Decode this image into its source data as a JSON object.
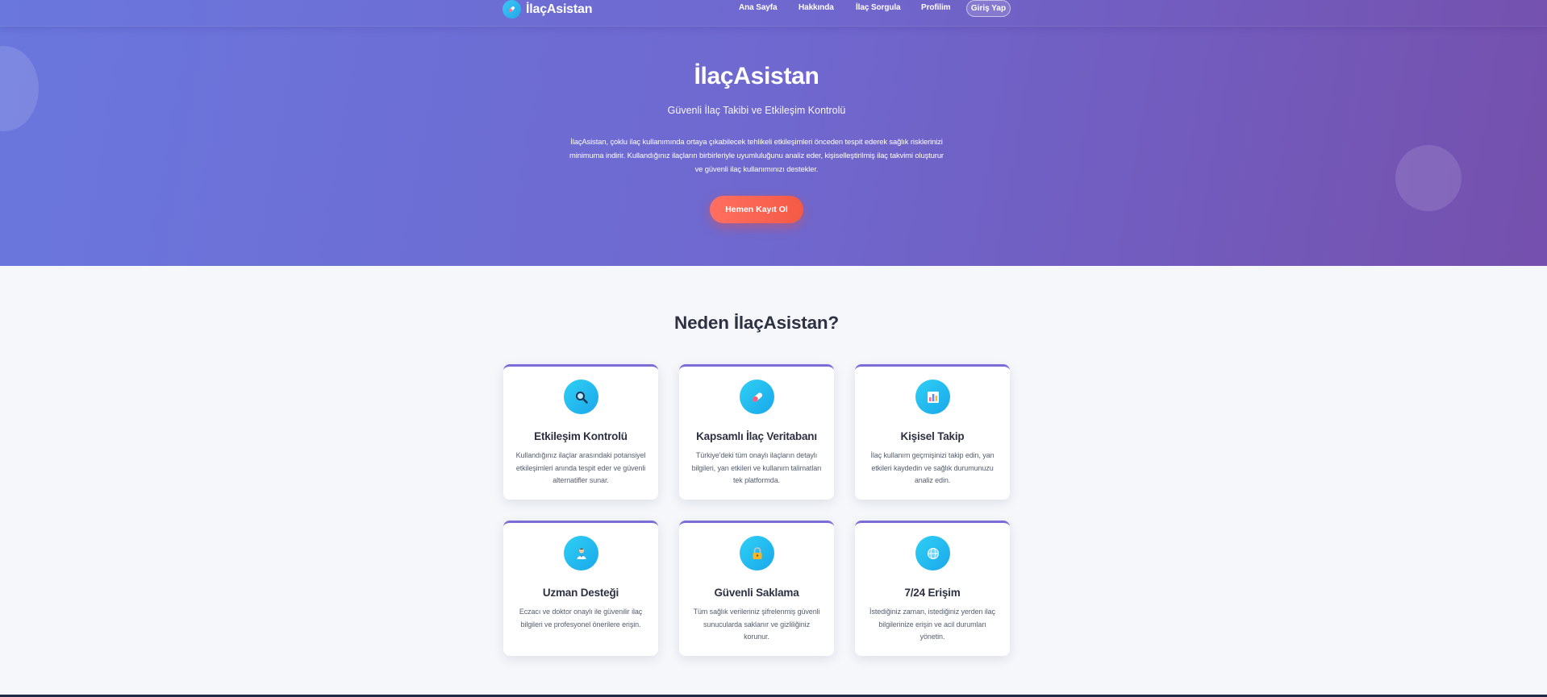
{
  "brand": {
    "name": "İlaçAsistan"
  },
  "nav": {
    "items": [
      "Ana Sayfa",
      "Hakkında",
      "İlaç Sorgula",
      "Profilim"
    ],
    "login_label": "Giriş Yap"
  },
  "hero": {
    "title": "İlaçAsistan",
    "subtitle": "Güvenli İlaç Takibi ve Etkileşim Kontrolü",
    "description": "İlaçAsistan, çoklu ilaç kullanımında ortaya çıkabilecek tehlikeli etkileşimleri önceden tespit ederek sağlık risklerinizi minimuma indirir. Kullandığınız ilaçların birbirleriyle uyumluluğunu analiz eder, kişiselleştirilmiş ilaç takvimi oluşturur ve güvenli ilaç kullanımınızı destekler.",
    "cta_label": "Hemen Kayıt Ol"
  },
  "features": {
    "title": "Neden İlaçAsistan?",
    "cards": [
      {
        "icon": "magnifier-icon",
        "title": "Etkileşim Kontrolü",
        "text": "Kullandığınız ilaçlar arasındaki potansiyel etkileşimleri anında tespit eder ve güvenli alternatifler sunar."
      },
      {
        "icon": "pill-icon",
        "title": "Kapsamlı İlaç Veritabanı",
        "text": "Türkiye'deki tüm onaylı ilaçların detaylı bilgileri, yan etkileri ve kullanım talimatları tek platformda."
      },
      {
        "icon": "bar-chart-icon",
        "title": "Kişisel Takip",
        "text": "İlaç kullanım geçmişinizi takip edin, yan etkileri kaydedin ve sağlık durumunuzu analiz edin."
      },
      {
        "icon": "doctor-icon",
        "title": "Uzman Desteği",
        "text": "Eczacı ve doktor onaylı ile güvenilir ilaç bilgileri ve profesyonel önerilere erişin."
      },
      {
        "icon": "lock-icon",
        "title": "Güvenli Saklama",
        "text": "Tüm sağlık verileriniz şifrelenmiş güvenli sunucularda saklanır ve gizliliğiniz korunur."
      },
      {
        "icon": "globe-icon",
        "title": "7/24 Erişim",
        "text": "İstediğiniz zaman, istediğiniz yerden ilaç bilgilerinize erişin ve acil durumları yönetin."
      }
    ]
  },
  "colors": {
    "hero_gradient_start": "#6a77dd",
    "hero_gradient_end": "#7550ad",
    "cta": "#f55a45",
    "icon_circle": "#1aa7ea",
    "card_top_border": "#7a6dd8"
  }
}
